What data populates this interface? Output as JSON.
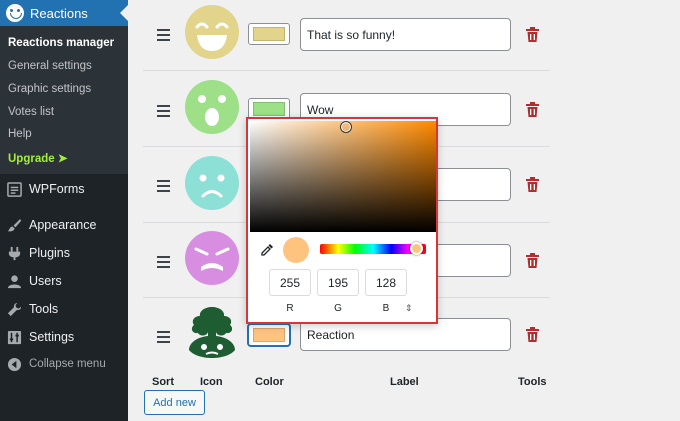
{
  "sidebar": {
    "active_menu": "Reactions",
    "submenu": [
      {
        "label": "Reactions manager",
        "current": true
      },
      {
        "label": "General settings"
      },
      {
        "label": "Graphic settings"
      },
      {
        "label": "Votes list"
      },
      {
        "label": "Help"
      },
      {
        "label": "Upgrade ➤",
        "upgrade": true
      }
    ],
    "menu": [
      {
        "label": "WPForms",
        "icon": "wpforms-icon"
      },
      {
        "label": "Appearance",
        "icon": "paintbrush-icon"
      },
      {
        "label": "Plugins",
        "icon": "plugin-icon"
      },
      {
        "label": "Users",
        "icon": "users-icon"
      },
      {
        "label": "Tools",
        "icon": "wrench-icon"
      },
      {
        "label": "Settings",
        "icon": "settings-icon"
      }
    ],
    "collapse_label": "Collapse menu"
  },
  "reactions": [
    {
      "label": "That is so funny!",
      "color": "#e2d58b",
      "face": "laugh"
    },
    {
      "label": "Wow",
      "color": "#9de088",
      "face": "wow"
    },
    {
      "label": "",
      "color": "#8de0d6",
      "face": "sad"
    },
    {
      "label": "",
      "color": "#d88ee0",
      "face": "angry"
    },
    {
      "label": "Reaction",
      "color": "#ffc380",
      "face": "tree"
    }
  ],
  "columns": {
    "sort": "Sort",
    "icon": "Icon",
    "color": "Color",
    "label": "Label",
    "tools": "Tools"
  },
  "add_new_label": "Add new",
  "color_picker": {
    "r": "255",
    "g": "195",
    "b": "128",
    "r_label": "R",
    "g_label": "G",
    "b_label": "B",
    "mode_toggle": "⇕",
    "preview_color": "#ffc380"
  },
  "colors": {
    "accent": "#2271b1",
    "danger": "#d63638",
    "trash": "#b32d2e",
    "upgrade": "#a4ee39"
  }
}
